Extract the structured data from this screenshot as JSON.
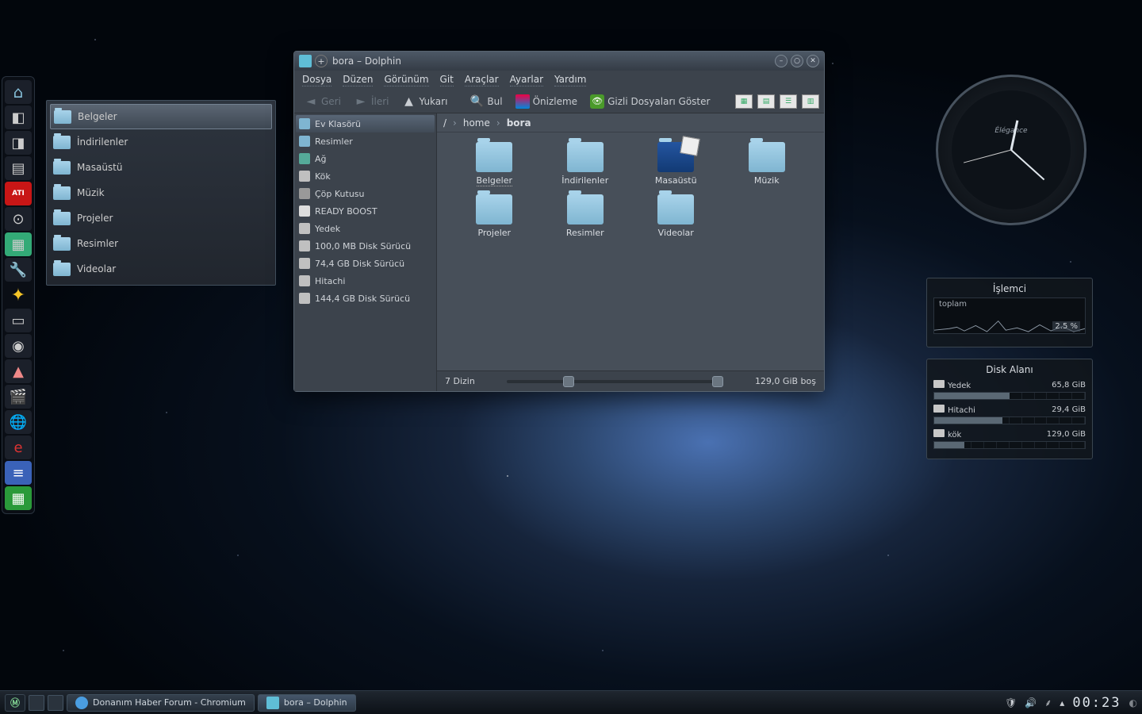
{
  "window": {
    "title": "bora – Dolphin",
    "menus": [
      "Dosya",
      "Düzen",
      "Görünüm",
      "Git",
      "Araçlar",
      "Ayarlar",
      "Yardım"
    ],
    "toolbar": {
      "back": "Geri",
      "forward": "İleri",
      "up": "Yukarı",
      "find": "Bul",
      "preview": "Önizleme",
      "hidden": "Gizli Dosyaları Göster"
    },
    "breadcrumb": {
      "root": "/",
      "seg1": "home",
      "seg2": "bora"
    },
    "places": [
      {
        "label": "Ev Klasörü",
        "sel": true,
        "ico": "folder"
      },
      {
        "label": "Resimler",
        "ico": "folder"
      },
      {
        "label": "Ağ",
        "ico": "net"
      },
      {
        "label": "Kök",
        "ico": "disk"
      },
      {
        "label": "Çöp Kutusu",
        "ico": "trash"
      },
      {
        "label": "READY BOOST",
        "ico": "usb"
      },
      {
        "label": "Yedek",
        "ico": "disk"
      },
      {
        "label": "100,0 MB Disk Sürücü",
        "ico": "disk"
      },
      {
        "label": "74,4 GB Disk Sürücü",
        "ico": "disk"
      },
      {
        "label": "Hitachi",
        "ico": "disk"
      },
      {
        "label": "144,4 GB Disk Sürücü",
        "ico": "disk"
      }
    ],
    "items": [
      {
        "label": "Belgeler",
        "sel": true
      },
      {
        "label": "İndirilenler"
      },
      {
        "label": "Masaüstü",
        "desk": true
      },
      {
        "label": "Müzik"
      },
      {
        "label": "Projeler"
      },
      {
        "label": "Resimler"
      },
      {
        "label": "Videolar"
      }
    ],
    "status": {
      "count": "7 Dizin",
      "free": "129,0 GiB boş"
    }
  },
  "side_popup": {
    "items": [
      "Belgeler",
      "İndirilenler",
      "Masaüstü",
      "Müzik",
      "Projeler",
      "Resimler",
      "Videolar"
    ]
  },
  "clock_widget": {
    "brand": "Élégance"
  },
  "cpu_widget": {
    "title": "İşlemci",
    "label": "toplam",
    "percent": "2.5 %"
  },
  "disk_widget": {
    "title": "Disk Alanı",
    "drives": [
      {
        "name": "Yedek",
        "size": "65,8 GiB",
        "fill": 50
      },
      {
        "name": "Hitachi",
        "size": "29,4 GiB",
        "fill": 45
      },
      {
        "name": "kök",
        "size": "129,0 GiB",
        "fill": 20
      }
    ]
  },
  "taskbar": {
    "tasks": [
      {
        "label": "Donanım Haber Forum - Chromium"
      },
      {
        "label": "bora – Dolphin"
      }
    ],
    "time": "00:23"
  }
}
